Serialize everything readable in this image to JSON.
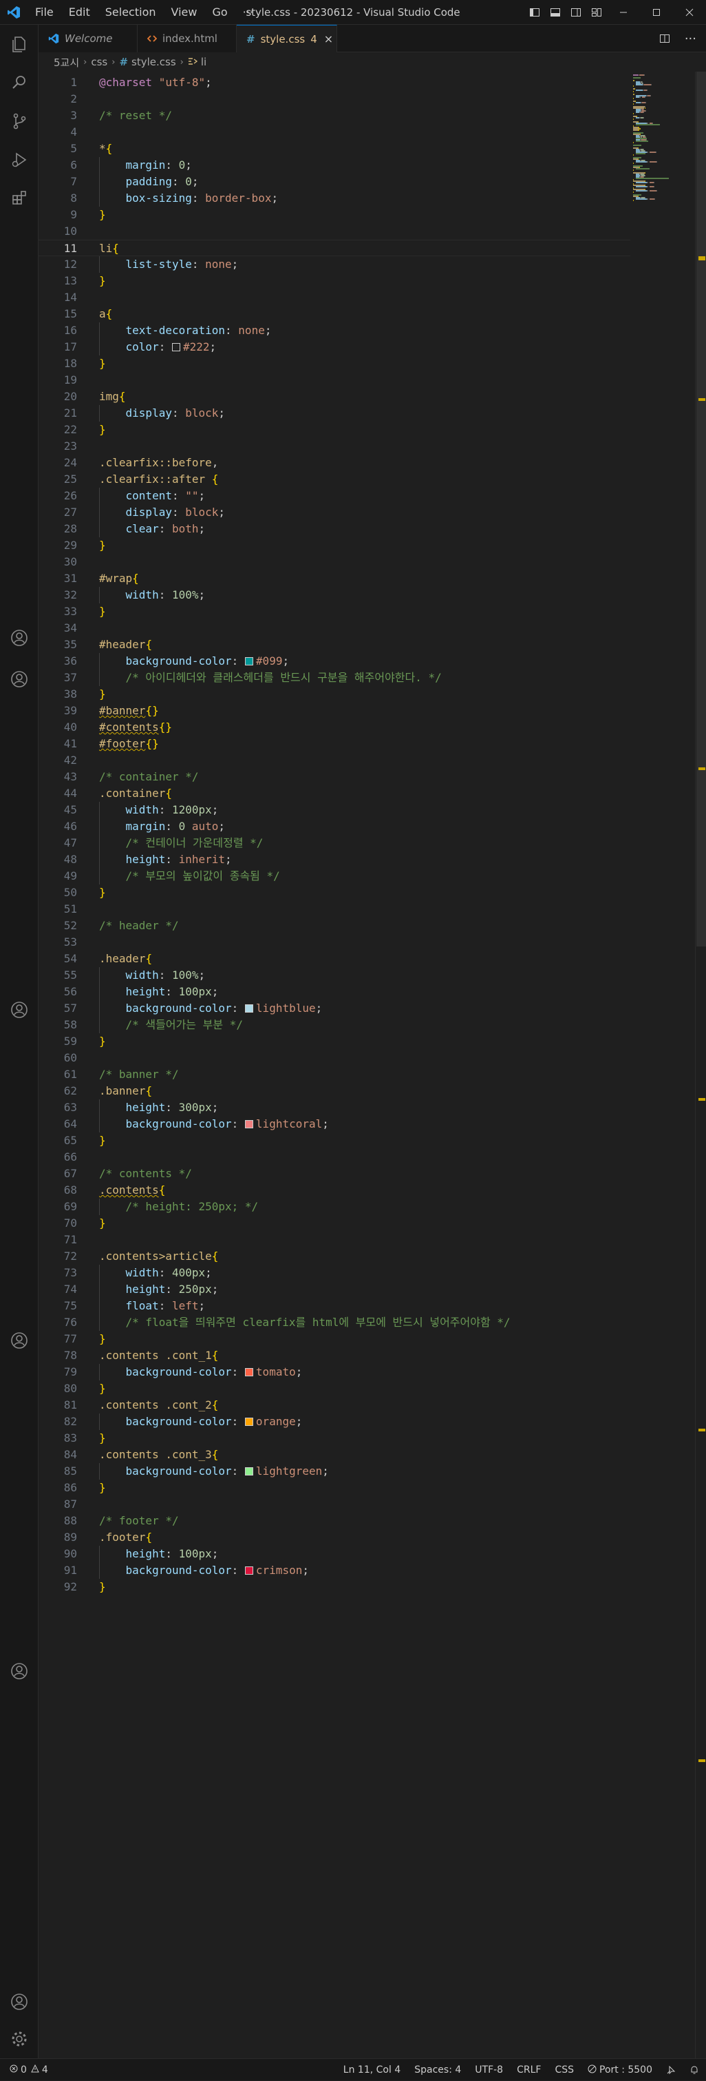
{
  "window": {
    "title": "style.css - 20230612 - Visual Studio Code"
  },
  "menu": [
    "File",
    "Edit",
    "Selection",
    "View",
    "Go",
    "···"
  ],
  "tabs": [
    {
      "label": "Welcome",
      "icon": "vscode-logo-icon"
    },
    {
      "label": "index.html",
      "icon": "html-file-icon"
    },
    {
      "label": "style.css",
      "icon": "css-hash-icon",
      "badge": "4",
      "close": "×"
    }
  ],
  "breadcrumb": [
    "5교시",
    "css",
    "style.css",
    "li"
  ],
  "editor": {
    "current_line": 11,
    "lines": [
      [
        [
          "t-at",
          "@charset"
        ],
        [
          "t-punc",
          " "
        ],
        [
          "t-str",
          "\"utf-8\""
        ],
        [
          "t-punc",
          ";"
        ]
      ],
      [],
      [
        [
          "t-com",
          "/* reset */"
        ]
      ],
      [],
      [
        [
          "t-sel",
          "*"
        ],
        [
          "t-brace",
          "{"
        ]
      ],
      [
        [
          "t-punc",
          "    "
        ],
        [
          "t-prop",
          "margin"
        ],
        [
          "t-punc",
          ": "
        ],
        [
          "t-num",
          "0"
        ],
        [
          "t-punc",
          ";"
        ]
      ],
      [
        [
          "t-punc",
          "    "
        ],
        [
          "t-prop",
          "padding"
        ],
        [
          "t-punc",
          ": "
        ],
        [
          "t-num",
          "0"
        ],
        [
          "t-punc",
          ";"
        ]
      ],
      [
        [
          "t-punc",
          "    "
        ],
        [
          "t-prop",
          "box-sizing"
        ],
        [
          "t-punc",
          ": "
        ],
        [
          "t-val",
          "border-box"
        ],
        [
          "t-punc",
          ";"
        ]
      ],
      [
        [
          "t-brace",
          "}"
        ]
      ],
      [],
      [
        [
          "t-sel",
          "li"
        ],
        [
          "t-brace",
          "{"
        ]
      ],
      [
        [
          "t-punc",
          "    "
        ],
        [
          "t-prop",
          "list-style"
        ],
        [
          "t-punc",
          ": "
        ],
        [
          "t-val",
          "none"
        ],
        [
          "t-punc",
          ";"
        ]
      ],
      [
        [
          "t-brace",
          "}"
        ]
      ],
      [],
      [
        [
          "t-sel",
          "a"
        ],
        [
          "t-brace",
          "{"
        ]
      ],
      [
        [
          "t-punc",
          "    "
        ],
        [
          "t-prop",
          "text-decoration"
        ],
        [
          "t-punc",
          ": "
        ],
        [
          "t-val",
          "none"
        ],
        [
          "t-punc",
          ";"
        ]
      ],
      [
        [
          "t-punc",
          "    "
        ],
        [
          "t-prop",
          "color"
        ],
        [
          "t-punc",
          ": "
        ],
        [
          "swatch",
          "#222222"
        ],
        [
          "t-val",
          "#222"
        ],
        [
          "t-punc",
          ";"
        ]
      ],
      [
        [
          "t-brace",
          "}"
        ]
      ],
      [],
      [
        [
          "t-sel",
          "img"
        ],
        [
          "t-brace",
          "{"
        ]
      ],
      [
        [
          "t-punc",
          "    "
        ],
        [
          "t-prop",
          "display"
        ],
        [
          "t-punc",
          ": "
        ],
        [
          "t-val",
          "block"
        ],
        [
          "t-punc",
          ";"
        ]
      ],
      [
        [
          "t-brace",
          "}"
        ]
      ],
      [],
      [
        [
          "t-sel",
          ".clearfix::before"
        ],
        [
          "t-punc",
          ","
        ]
      ],
      [
        [
          "t-sel",
          ".clearfix::after"
        ],
        [
          "t-punc",
          " "
        ],
        [
          "t-brace",
          "{"
        ]
      ],
      [
        [
          "t-punc",
          "    "
        ],
        [
          "t-prop",
          "content"
        ],
        [
          "t-punc",
          ": "
        ],
        [
          "t-str",
          "\"\""
        ],
        [
          "t-punc",
          ";"
        ]
      ],
      [
        [
          "t-punc",
          "    "
        ],
        [
          "t-prop",
          "display"
        ],
        [
          "t-punc",
          ": "
        ],
        [
          "t-val",
          "block"
        ],
        [
          "t-punc",
          ";"
        ]
      ],
      [
        [
          "t-punc",
          "    "
        ],
        [
          "t-prop",
          "clear"
        ],
        [
          "t-punc",
          ": "
        ],
        [
          "t-val",
          "both"
        ],
        [
          "t-punc",
          ";"
        ]
      ],
      [
        [
          "t-brace",
          "}"
        ]
      ],
      [],
      [
        [
          "t-sel",
          "#wrap"
        ],
        [
          "t-brace",
          "{"
        ]
      ],
      [
        [
          "t-punc",
          "    "
        ],
        [
          "t-prop",
          "width"
        ],
        [
          "t-punc",
          ": "
        ],
        [
          "t-num",
          "100%"
        ],
        [
          "t-punc",
          ";"
        ]
      ],
      [
        [
          "t-brace",
          "}"
        ]
      ],
      [],
      [
        [
          "t-sel",
          "#header"
        ],
        [
          "t-brace",
          "{"
        ]
      ],
      [
        [
          "t-punc",
          "    "
        ],
        [
          "t-prop",
          "background-color"
        ],
        [
          "t-punc",
          ": "
        ],
        [
          "swatch",
          "#009999"
        ],
        [
          "t-val",
          "#099"
        ],
        [
          "t-punc",
          ";"
        ]
      ],
      [
        [
          "t-punc",
          "    "
        ],
        [
          "t-com",
          "/* 아이디헤더와 클래스헤더를 반드시 구분을 해주어야한다. */"
        ]
      ],
      [
        [
          "t-brace",
          "}"
        ]
      ],
      [
        [
          "sq-t-sel",
          "#banner"
        ],
        [
          "t-brace",
          "{}"
        ]
      ],
      [
        [
          "sq-t-sel",
          "#contents"
        ],
        [
          "t-brace",
          "{}"
        ]
      ],
      [
        [
          "sq-t-sel",
          "#footer"
        ],
        [
          "t-brace",
          "{}"
        ]
      ],
      [],
      [
        [
          "t-com",
          "/* container */"
        ]
      ],
      [
        [
          "t-sel",
          ".container"
        ],
        [
          "t-brace",
          "{"
        ]
      ],
      [
        [
          "t-punc",
          "    "
        ],
        [
          "t-prop",
          "width"
        ],
        [
          "t-punc",
          ": "
        ],
        [
          "t-num",
          "1200px"
        ],
        [
          "t-punc",
          ";"
        ]
      ],
      [
        [
          "t-punc",
          "    "
        ],
        [
          "t-prop",
          "margin"
        ],
        [
          "t-punc",
          ": "
        ],
        [
          "t-num",
          "0"
        ],
        [
          "t-punc",
          " "
        ],
        [
          "t-val",
          "auto"
        ],
        [
          "t-punc",
          ";"
        ]
      ],
      [
        [
          "t-punc",
          "    "
        ],
        [
          "t-com",
          "/* 컨테이너 가운데정렬 */"
        ]
      ],
      [
        [
          "t-punc",
          "    "
        ],
        [
          "t-prop",
          "height"
        ],
        [
          "t-punc",
          ": "
        ],
        [
          "t-val",
          "inherit"
        ],
        [
          "t-punc",
          ";"
        ]
      ],
      [
        [
          "t-punc",
          "    "
        ],
        [
          "t-com",
          "/* 부모의 높이값이 종속됨 */"
        ]
      ],
      [
        [
          "t-brace",
          "}"
        ]
      ],
      [],
      [
        [
          "t-com",
          "/* header */"
        ]
      ],
      [],
      [
        [
          "t-sel",
          ".header"
        ],
        [
          "t-brace",
          "{"
        ]
      ],
      [
        [
          "t-punc",
          "    "
        ],
        [
          "t-prop",
          "width"
        ],
        [
          "t-punc",
          ": "
        ],
        [
          "t-num",
          "100%"
        ],
        [
          "t-punc",
          ";"
        ]
      ],
      [
        [
          "t-punc",
          "    "
        ],
        [
          "t-prop",
          "height"
        ],
        [
          "t-punc",
          ": "
        ],
        [
          "t-num",
          "100px"
        ],
        [
          "t-punc",
          ";"
        ]
      ],
      [
        [
          "t-punc",
          "    "
        ],
        [
          "t-prop",
          "background-color"
        ],
        [
          "t-punc",
          ": "
        ],
        [
          "swatch",
          "#add8e6"
        ],
        [
          "t-val",
          "lightblue"
        ],
        [
          "t-punc",
          ";"
        ]
      ],
      [
        [
          "t-punc",
          "    "
        ],
        [
          "t-com",
          "/* 색들어가는 부분 */"
        ]
      ],
      [
        [
          "t-brace",
          "}"
        ]
      ],
      [],
      [
        [
          "t-com",
          "/* banner */"
        ]
      ],
      [
        [
          "t-sel",
          ".banner"
        ],
        [
          "t-brace",
          "{"
        ]
      ],
      [
        [
          "t-punc",
          "    "
        ],
        [
          "t-prop",
          "height"
        ],
        [
          "t-punc",
          ": "
        ],
        [
          "t-num",
          "300px"
        ],
        [
          "t-punc",
          ";"
        ]
      ],
      [
        [
          "t-punc",
          "    "
        ],
        [
          "t-prop",
          "background-color"
        ],
        [
          "t-punc",
          ": "
        ],
        [
          "swatch",
          "#f08080"
        ],
        [
          "t-val",
          "lightcoral"
        ],
        [
          "t-punc",
          ";"
        ]
      ],
      [
        [
          "t-brace",
          "}"
        ]
      ],
      [],
      [
        [
          "t-com",
          "/* contents */"
        ]
      ],
      [
        [
          "sq-t-sel",
          ".contents"
        ],
        [
          "t-brace",
          "{"
        ]
      ],
      [
        [
          "t-punc",
          "    "
        ],
        [
          "t-com",
          "/* height: 250px; */"
        ]
      ],
      [
        [
          "t-brace",
          "}"
        ]
      ],
      [],
      [
        [
          "t-sel",
          ".contents>article"
        ],
        [
          "t-brace",
          "{"
        ]
      ],
      [
        [
          "t-punc",
          "    "
        ],
        [
          "t-prop",
          "width"
        ],
        [
          "t-punc",
          ": "
        ],
        [
          "t-num",
          "400px"
        ],
        [
          "t-punc",
          ";"
        ]
      ],
      [
        [
          "t-punc",
          "    "
        ],
        [
          "t-prop",
          "height"
        ],
        [
          "t-punc",
          ": "
        ],
        [
          "t-num",
          "250px"
        ],
        [
          "t-punc",
          ";"
        ]
      ],
      [
        [
          "t-punc",
          "    "
        ],
        [
          "t-prop",
          "float"
        ],
        [
          "t-punc",
          ": "
        ],
        [
          "t-val",
          "left"
        ],
        [
          "t-punc",
          ";"
        ]
      ],
      [
        [
          "t-punc",
          "    "
        ],
        [
          "t-com",
          "/* float을 띄워주면 clearfix를 html에 부모에 반드시 넣어주어야함 */"
        ]
      ],
      [
        [
          "t-brace",
          "}"
        ]
      ],
      [
        [
          "t-sel",
          ".contents .cont_1"
        ],
        [
          "t-brace",
          "{"
        ]
      ],
      [
        [
          "t-punc",
          "    "
        ],
        [
          "t-prop",
          "background-color"
        ],
        [
          "t-punc",
          ": "
        ],
        [
          "swatch",
          "#ff6347"
        ],
        [
          "t-val",
          "tomato"
        ],
        [
          "t-punc",
          ";"
        ]
      ],
      [
        [
          "t-brace",
          "}"
        ]
      ],
      [
        [
          "t-sel",
          ".contents .cont_2"
        ],
        [
          "t-brace",
          "{"
        ]
      ],
      [
        [
          "t-punc",
          "    "
        ],
        [
          "t-prop",
          "background-color"
        ],
        [
          "t-punc",
          ": "
        ],
        [
          "swatch",
          "#ffa500"
        ],
        [
          "t-val",
          "orange"
        ],
        [
          "t-punc",
          ";"
        ]
      ],
      [
        [
          "t-brace",
          "}"
        ]
      ],
      [
        [
          "t-sel",
          ".contents .cont_3"
        ],
        [
          "t-brace",
          "{"
        ]
      ],
      [
        [
          "t-punc",
          "    "
        ],
        [
          "t-prop",
          "background-color"
        ],
        [
          "t-punc",
          ": "
        ],
        [
          "swatch",
          "#90ee90"
        ],
        [
          "t-val",
          "lightgreen"
        ],
        [
          "t-punc",
          ";"
        ]
      ],
      [
        [
          "t-brace",
          "}"
        ]
      ],
      [],
      [
        [
          "t-com",
          "/* footer */"
        ]
      ],
      [
        [
          "t-sel",
          ".footer"
        ],
        [
          "t-brace",
          "{"
        ]
      ],
      [
        [
          "t-punc",
          "    "
        ],
        [
          "t-prop",
          "height"
        ],
        [
          "t-punc",
          ": "
        ],
        [
          "t-num",
          "100px"
        ],
        [
          "t-punc",
          ";"
        ]
      ],
      [
        [
          "t-punc",
          "    "
        ],
        [
          "t-prop",
          "background-color"
        ],
        [
          "t-punc",
          ": "
        ],
        [
          "swatch",
          "#dc143c"
        ],
        [
          "t-val",
          "crimson"
        ],
        [
          "t-punc",
          ";"
        ]
      ],
      [
        [
          "t-brace",
          "}"
        ]
      ]
    ]
  },
  "statusbar": {
    "errors": "0",
    "warnings": "4",
    "position": "Ln 11, Col 4",
    "spaces": "Spaces: 4",
    "encoding": "UTF-8",
    "eol": "CRLF",
    "language": "CSS",
    "port": "Port : 5500"
  },
  "colors": {
    "accent": "#0078d4",
    "warning": "#cca700",
    "background": "#1f1f1f"
  }
}
